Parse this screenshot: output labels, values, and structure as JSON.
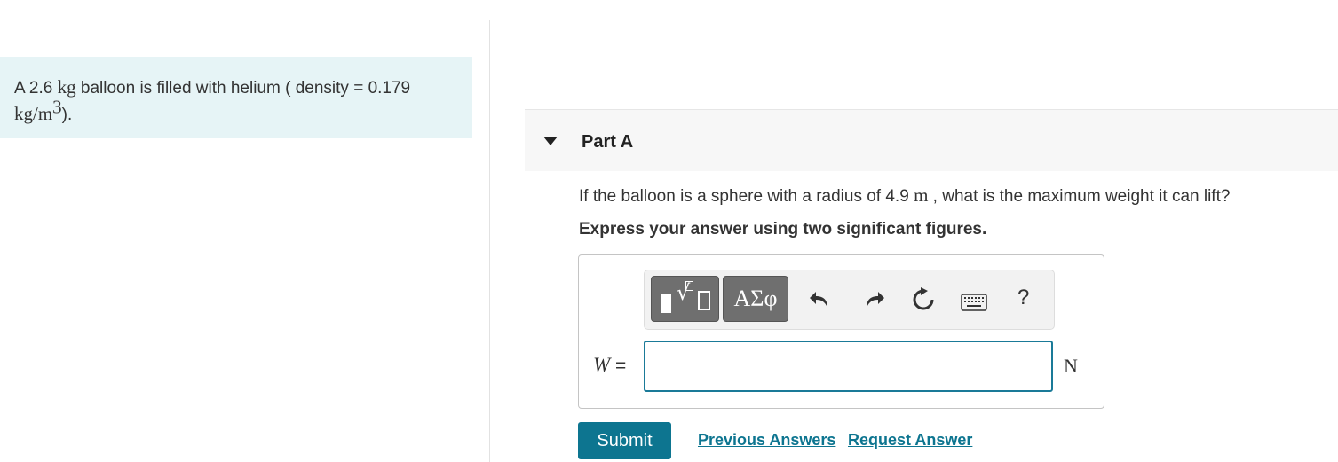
{
  "problem": {
    "text_a": "A 2.6 ",
    "mass_unit": "kg",
    "text_b": " balloon is filled with helium ( density = 0.179",
    "density_unit_base": "kg/m",
    "density_exponent": "3",
    "text_c": ")."
  },
  "part": {
    "title": "Part A",
    "question_a": "If the balloon is a sphere with a radius of 4.9 ",
    "radius_unit": "m",
    "question_b": " , what is the maximum weight it can lift?",
    "instruction": "Express your answer using two significant figures."
  },
  "toolbar": {
    "templates_icon": "templates-icon",
    "greek_label": "ΑΣφ",
    "undo_icon": "undo-icon",
    "redo_icon": "redo-icon",
    "reset_icon": "reset-icon",
    "keyboard_icon": "keyboard-icon",
    "help_label": "?"
  },
  "answer": {
    "variable": "W",
    "equals": " =",
    "value": "",
    "unit": "N"
  },
  "actions": {
    "submit_label": "Submit",
    "previous_answers_label": "Previous Answers",
    "request_answer_label": "Request Answer"
  },
  "colors": {
    "accent": "#0d7590",
    "intro_background": "#e6f4f6",
    "input_border": "#1a7a98"
  }
}
